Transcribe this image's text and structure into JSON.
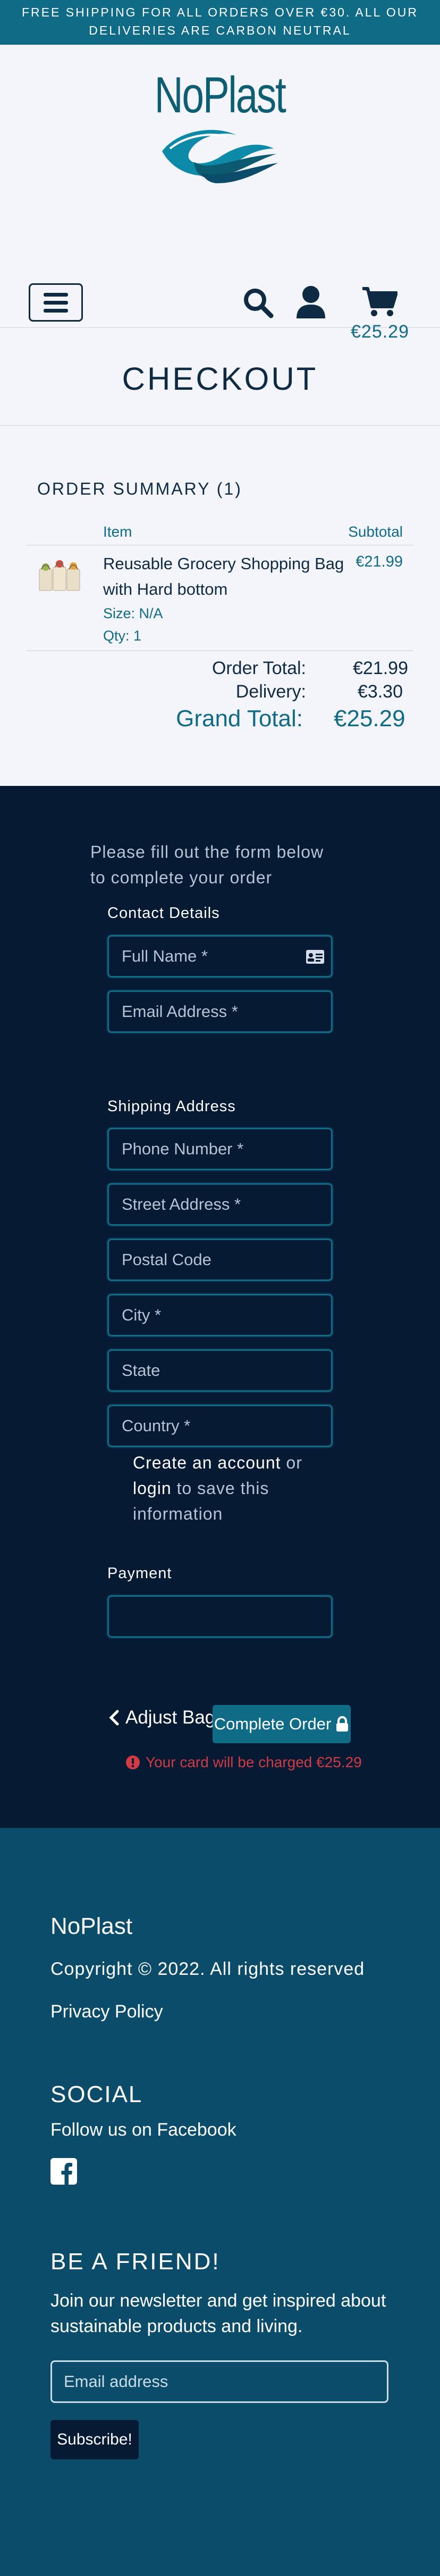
{
  "banner": {
    "line1": "FREE SHIPPING FOR ALL ORDERS OVER €30. ALL OUR",
    "line2": "DELIVERIES ARE CARBON NEUTRAL"
  },
  "header": {
    "logo_text": "NoPlast",
    "cart_total": "€25.29",
    "icons": [
      "menu-icon",
      "search-icon",
      "user-icon",
      "cart-icon"
    ],
    "accent_color": "#0f6b86",
    "navy_color": "#061a34"
  },
  "page_title": "CHECKOUT",
  "summary": {
    "heading": "ORDER SUMMARY (1)",
    "columns": {
      "item": "Item",
      "subtotal": "Subtotal"
    },
    "items": [
      {
        "name": "Reusable Grocery Shopping Bag with Hard bottom",
        "size": "Size: N/A",
        "qty": "Qty: 1",
        "subtotal": "€21.99"
      }
    ],
    "order_total_label": "Order Total:",
    "order_total": "€21.99",
    "delivery_label": "Delivery:",
    "delivery": "€3.30",
    "grand_total_label": "Grand Total:",
    "grand_total": "€25.29"
  },
  "form": {
    "intro": "Please fill out the form below to complete your order",
    "contact_label": "Contact Details",
    "full_name_placeholder": "Full Name *",
    "email_placeholder": "Email Address *",
    "shipping_label": "Shipping Address",
    "phone_placeholder": "Phone Number *",
    "street_placeholder": "Street Address *",
    "postal_placeholder": "Postal Code",
    "city_placeholder": "City *",
    "state_placeholder": "State",
    "country_placeholder": "Country *",
    "create_account_link": "Create an account",
    "or_text": "or",
    "login_link": "login",
    "save_text": "to save this information",
    "payment_label": "Payment",
    "adjust_bag_label": "Adjust Bag",
    "complete_order_label": "Complete Order",
    "charge_note": "Your card will be charged €25.29",
    "warning_color": "#d33a45"
  },
  "footer": {
    "brand": "NoPlast",
    "copyright": "Copyright © 2022. All rights reserved",
    "privacy": "Privacy Policy",
    "social_heading": "SOCIAL",
    "follow_text": "Follow us on Facebook",
    "friend_heading": "BE A FRIEND!",
    "join_text": "Join our newsletter and get inspired about sustainable products and living.",
    "email_placeholder": "Email address",
    "subscribe_label": "Subscribe!"
  }
}
